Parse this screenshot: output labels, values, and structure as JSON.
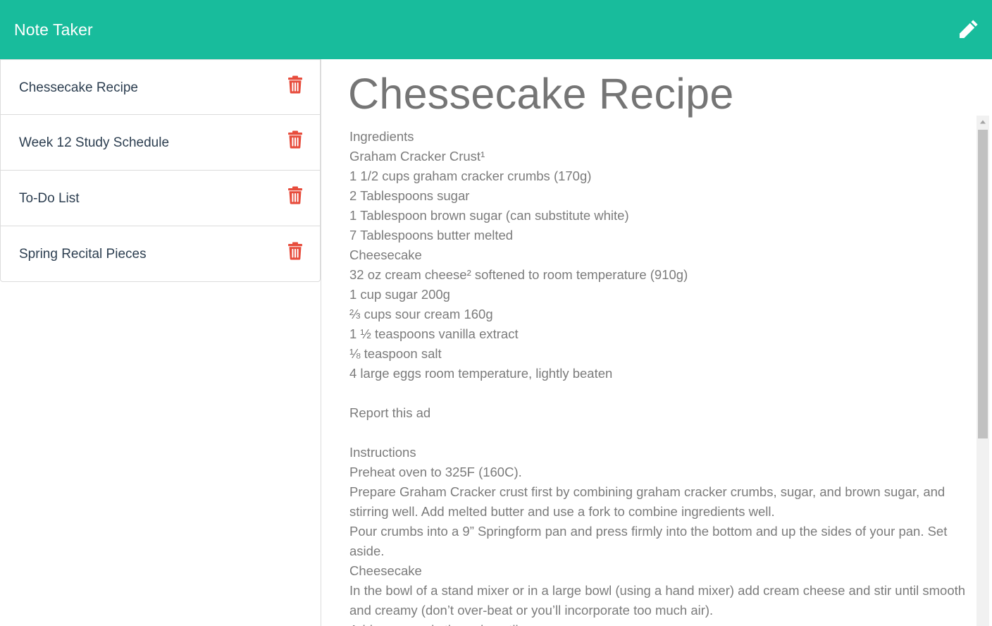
{
  "app": {
    "title": "Note Taker",
    "accent_color": "#18bc9c",
    "danger_color": "#e74c3c"
  },
  "header": {
    "new_note_icon": "pencil-icon"
  },
  "sidebar": {
    "notes": [
      {
        "title": "Chessecake Recipe",
        "delete_icon": "trash-icon"
      },
      {
        "title": "Week 12 Study Schedule",
        "delete_icon": "trash-icon"
      },
      {
        "title": "To-Do List",
        "delete_icon": "trash-icon"
      },
      {
        "title": "Spring Recital Pieces",
        "delete_icon": "trash-icon"
      }
    ]
  },
  "active_note": {
    "title": "Chessecake Recipe",
    "text": "Ingredients\nGraham Cracker Crust¹\n1 1/2 cups graham cracker crumbs (170g)\n2 Tablespoons sugar\n1 Tablespoon brown sugar (can substitute white)\n7 Tablespoons butter melted\nCheesecake\n32 oz cream cheese² softened to room temperature (910g)\n1 cup sugar 200g\n⅔ cups sour cream 160g\n1 ½ teaspoons vanilla extract\n⅛ teaspoon salt\n4 large eggs room temperature, lightly beaten\n\nReport this ad\n\nInstructions\nPreheat oven to 325F (160C).\nPrepare Graham Cracker crust first by combining graham cracker crumbs, sugar, and brown sugar, and stirring well. Add melted butter and use a fork to combine ingredients well.\nPour crumbs into a 9” Springform pan and press firmly into the bottom and up the sides of your pan. Set aside.\nCheesecake\nIn the bowl of a stand mixer or in a large bowl (using a hand mixer) add cream cheese and stir until smooth and creamy (don’t over-beat or you’ll incorporate too much air).\nAdd sugar and stir again until creamy."
  }
}
